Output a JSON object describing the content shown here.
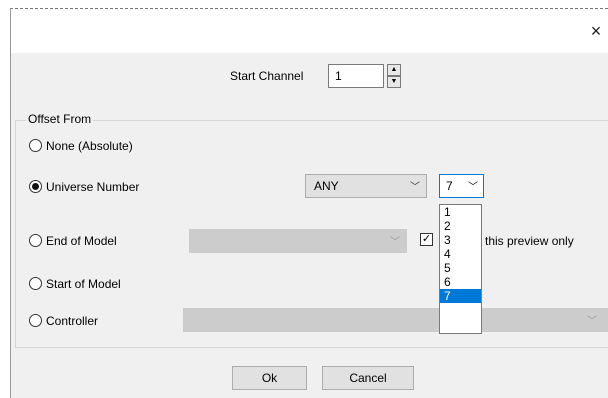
{
  "window": {
    "close_glyph": "×"
  },
  "start_channel": {
    "label": "Start Channel",
    "value": "1"
  },
  "offset_group": {
    "title": "Offset From"
  },
  "radios": {
    "none": "None (Absolute)",
    "universe": "Universe Number",
    "end_of_model": "End of Model",
    "start_of_model": "Start of Model",
    "controller": "Controller"
  },
  "universe_combo": {
    "value": "ANY"
  },
  "universe_number_combo": {
    "value": "7"
  },
  "universe_dropdown": {
    "options": [
      "1",
      "2",
      "3",
      "4",
      "5",
      "6",
      "7"
    ],
    "selected": "7"
  },
  "preview_checkbox": {
    "label": "this preview only",
    "checked": true
  },
  "buttons": {
    "ok": "Ok",
    "cancel": "Cancel"
  },
  "icons": {
    "close": "close-icon",
    "spin_up": "spin-up-icon",
    "spin_down": "spin-down-icon",
    "chevron": "chevron-down-icon",
    "check": "check-icon"
  },
  "colors": {
    "selection": "#0078d7",
    "dialog_bg": "#f0f0f0",
    "disabled": "#cccccc"
  }
}
